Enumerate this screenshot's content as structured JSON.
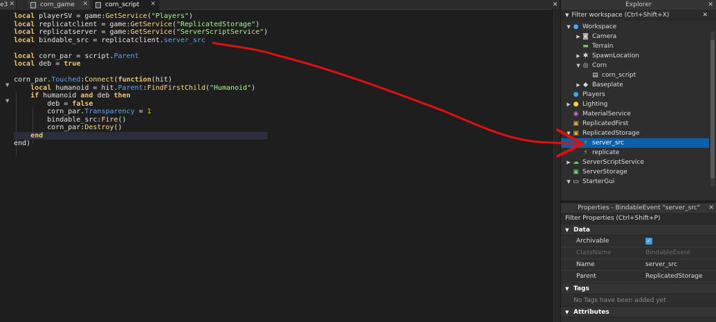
{
  "tabs": [
    {
      "label": "e3",
      "active": false
    },
    {
      "label": "corn_game",
      "active": false
    },
    {
      "label": "corn_script",
      "active": true
    }
  ],
  "code_lines": [
    [
      [
        "k",
        "local"
      ],
      [
        "t",
        " playerSV = game:"
      ],
      [
        "f",
        "GetService"
      ],
      [
        "t",
        "("
      ],
      [
        "s",
        "\"Players\""
      ],
      [
        "t",
        ")"
      ]
    ],
    [
      [
        "k",
        "local"
      ],
      [
        "t",
        " replicatclient = game:"
      ],
      [
        "f",
        "GetService"
      ],
      [
        "t",
        "("
      ],
      [
        "s",
        "\"ReplicatedStorage\""
      ],
      [
        "t",
        ")"
      ]
    ],
    [
      [
        "k",
        "local"
      ],
      [
        "t",
        " replicatserver = game:"
      ],
      [
        "f",
        "GetService"
      ],
      [
        "t",
        "("
      ],
      [
        "s",
        "\"ServerScriptService\""
      ],
      [
        "t",
        ")"
      ]
    ],
    [
      [
        "k",
        "local"
      ],
      [
        "t",
        " bindable_src = replicatclient."
      ],
      [
        "p",
        "server_src"
      ]
    ],
    [],
    [
      [
        "k",
        "local"
      ],
      [
        "t",
        " corn_par = script."
      ],
      [
        "p",
        "Parent"
      ]
    ],
    [
      [
        "k",
        "local"
      ],
      [
        "t",
        " deb = "
      ],
      [
        "k",
        "true"
      ]
    ],
    [],
    [
      [
        "t",
        "corn_par."
      ],
      [
        "p",
        "Touched"
      ],
      [
        "t",
        ":"
      ],
      [
        "f",
        "Connect"
      ],
      [
        "t",
        "("
      ],
      [
        "k",
        "function"
      ],
      [
        "t",
        "(hit)"
      ]
    ],
    [
      [
        "t",
        "    "
      ],
      [
        "k",
        "local"
      ],
      [
        "t",
        " humanoid = hit."
      ],
      [
        "p",
        "Parent"
      ],
      [
        "t",
        ":"
      ],
      [
        "f",
        "FindFirstChild"
      ],
      [
        "t",
        "("
      ],
      [
        "s",
        "\"Humanoid\""
      ],
      [
        "t",
        ")"
      ]
    ],
    [
      [
        "t",
        "    "
      ],
      [
        "k",
        "if"
      ],
      [
        "t",
        " humanoid "
      ],
      [
        "k",
        "and"
      ],
      [
        "t",
        " deb "
      ],
      [
        "k",
        "then"
      ]
    ],
    [
      [
        "t",
        "        deb = "
      ],
      [
        "k",
        "false"
      ]
    ],
    [
      [
        "t",
        "        corn_par."
      ],
      [
        "p",
        "Transparency"
      ],
      [
        "t",
        " = "
      ],
      [
        "n",
        "1"
      ]
    ],
    [
      [
        "t",
        "        bindable_src:"
      ],
      [
        "f",
        "Fire"
      ],
      [
        "t",
        "()"
      ]
    ],
    [
      [
        "t",
        "        corn_par:"
      ],
      [
        "f",
        "Destroy"
      ],
      [
        "t",
        "()"
      ]
    ],
    [
      [
        "t",
        "    "
      ],
      [
        "k",
        "end"
      ]
    ],
    [
      [
        "t",
        "end)"
      ]
    ]
  ],
  "explorer": {
    "title": "Explorer",
    "filter": "Filter workspace (Ctrl+Shift+X)",
    "items": [
      {
        "label": "Workspace",
        "depth": 0,
        "arrow": "▼",
        "icon": "workspace-icon",
        "glyph": "●",
        "color": "#4aa3ff"
      },
      {
        "label": "Camera",
        "depth": 1,
        "arrow": "▶",
        "icon": "camera-icon",
        "glyph": "◙",
        "color": "#cccccc"
      },
      {
        "label": "Terrain",
        "depth": 1,
        "arrow": "",
        "icon": "terrain-icon",
        "glyph": "▬",
        "color": "#7ec46f"
      },
      {
        "label": "SpawnLocation",
        "depth": 1,
        "arrow": "▶",
        "icon": "spawn-icon",
        "glyph": "✱",
        "color": "#dddddd"
      },
      {
        "label": "Corn",
        "depth": 1,
        "arrow": "▼",
        "icon": "model-icon",
        "glyph": "◎",
        "color": "#dddddd"
      },
      {
        "label": "corn_script",
        "depth": 2,
        "arrow": "",
        "icon": "script-icon",
        "glyph": "▤",
        "color": "#dddddd"
      },
      {
        "label": "Baseplate",
        "depth": 1,
        "arrow": "▶",
        "icon": "part-icon",
        "glyph": "◆",
        "color": "#dddddd"
      },
      {
        "label": "Players",
        "depth": 0,
        "arrow": "",
        "icon": "players-icon",
        "glyph": "●",
        "color": "#3da8e8"
      },
      {
        "label": "Lighting",
        "depth": 0,
        "arrow": "▶",
        "icon": "lighting-icon",
        "glyph": "●",
        "color": "#f5d547"
      },
      {
        "label": "MaterialService",
        "depth": 0,
        "arrow": "",
        "icon": "material-icon",
        "glyph": "◉",
        "color": "#d06bd0"
      },
      {
        "label": "ReplicatedFirst",
        "depth": 0,
        "arrow": "",
        "icon": "replicatedfirst-icon",
        "glyph": "▣",
        "color": "#e0a640"
      },
      {
        "label": "ReplicatedStorage",
        "depth": 0,
        "arrow": "▼",
        "icon": "replicatedstorage-icon",
        "glyph": "▣",
        "color": "#e0a640"
      },
      {
        "label": "server_src",
        "depth": 1,
        "arrow": "",
        "icon": "bindable-event-icon",
        "glyph": "⚡",
        "color": "#ffb000",
        "selected": true
      },
      {
        "label": "replicate",
        "depth": 1,
        "arrow": "",
        "icon": "bindable-event-icon",
        "glyph": "⚡",
        "color": "#ffb000"
      },
      {
        "label": "ServerScriptService",
        "depth": 0,
        "arrow": "▶",
        "icon": "serverscript-icon",
        "glyph": "☁",
        "color": "#6fcf6f"
      },
      {
        "label": "ServerStorage",
        "depth": 0,
        "arrow": "",
        "icon": "serverstorage-icon",
        "glyph": "▣",
        "color": "#6fcf6f"
      },
      {
        "label": "StarterGui",
        "depth": 0,
        "arrow": "▼",
        "icon": "startergui-icon",
        "glyph": "▭",
        "color": "#dddddd"
      }
    ]
  },
  "properties": {
    "title": "Properties - BindableEvent \"server_src\"",
    "filter": "Filter Properties (Ctrl+Shift+P)",
    "data_section": "Data",
    "rows": [
      {
        "name": "Archivable",
        "value": "",
        "checkbox": true,
        "disabled": false
      },
      {
        "name": "ClassName",
        "value": "BindableEvent",
        "checkbox": false,
        "disabled": true
      },
      {
        "name": "Name",
        "value": "server_src",
        "checkbox": false,
        "disabled": false
      },
      {
        "name": "Parent",
        "value": "ReplicatedStorage",
        "checkbox": false,
        "disabled": false
      }
    ],
    "tags_section": "Tags",
    "tags_note": "No Tags have been added yet",
    "attributes_section": "Attributes"
  },
  "annotation_color": "#e01010"
}
